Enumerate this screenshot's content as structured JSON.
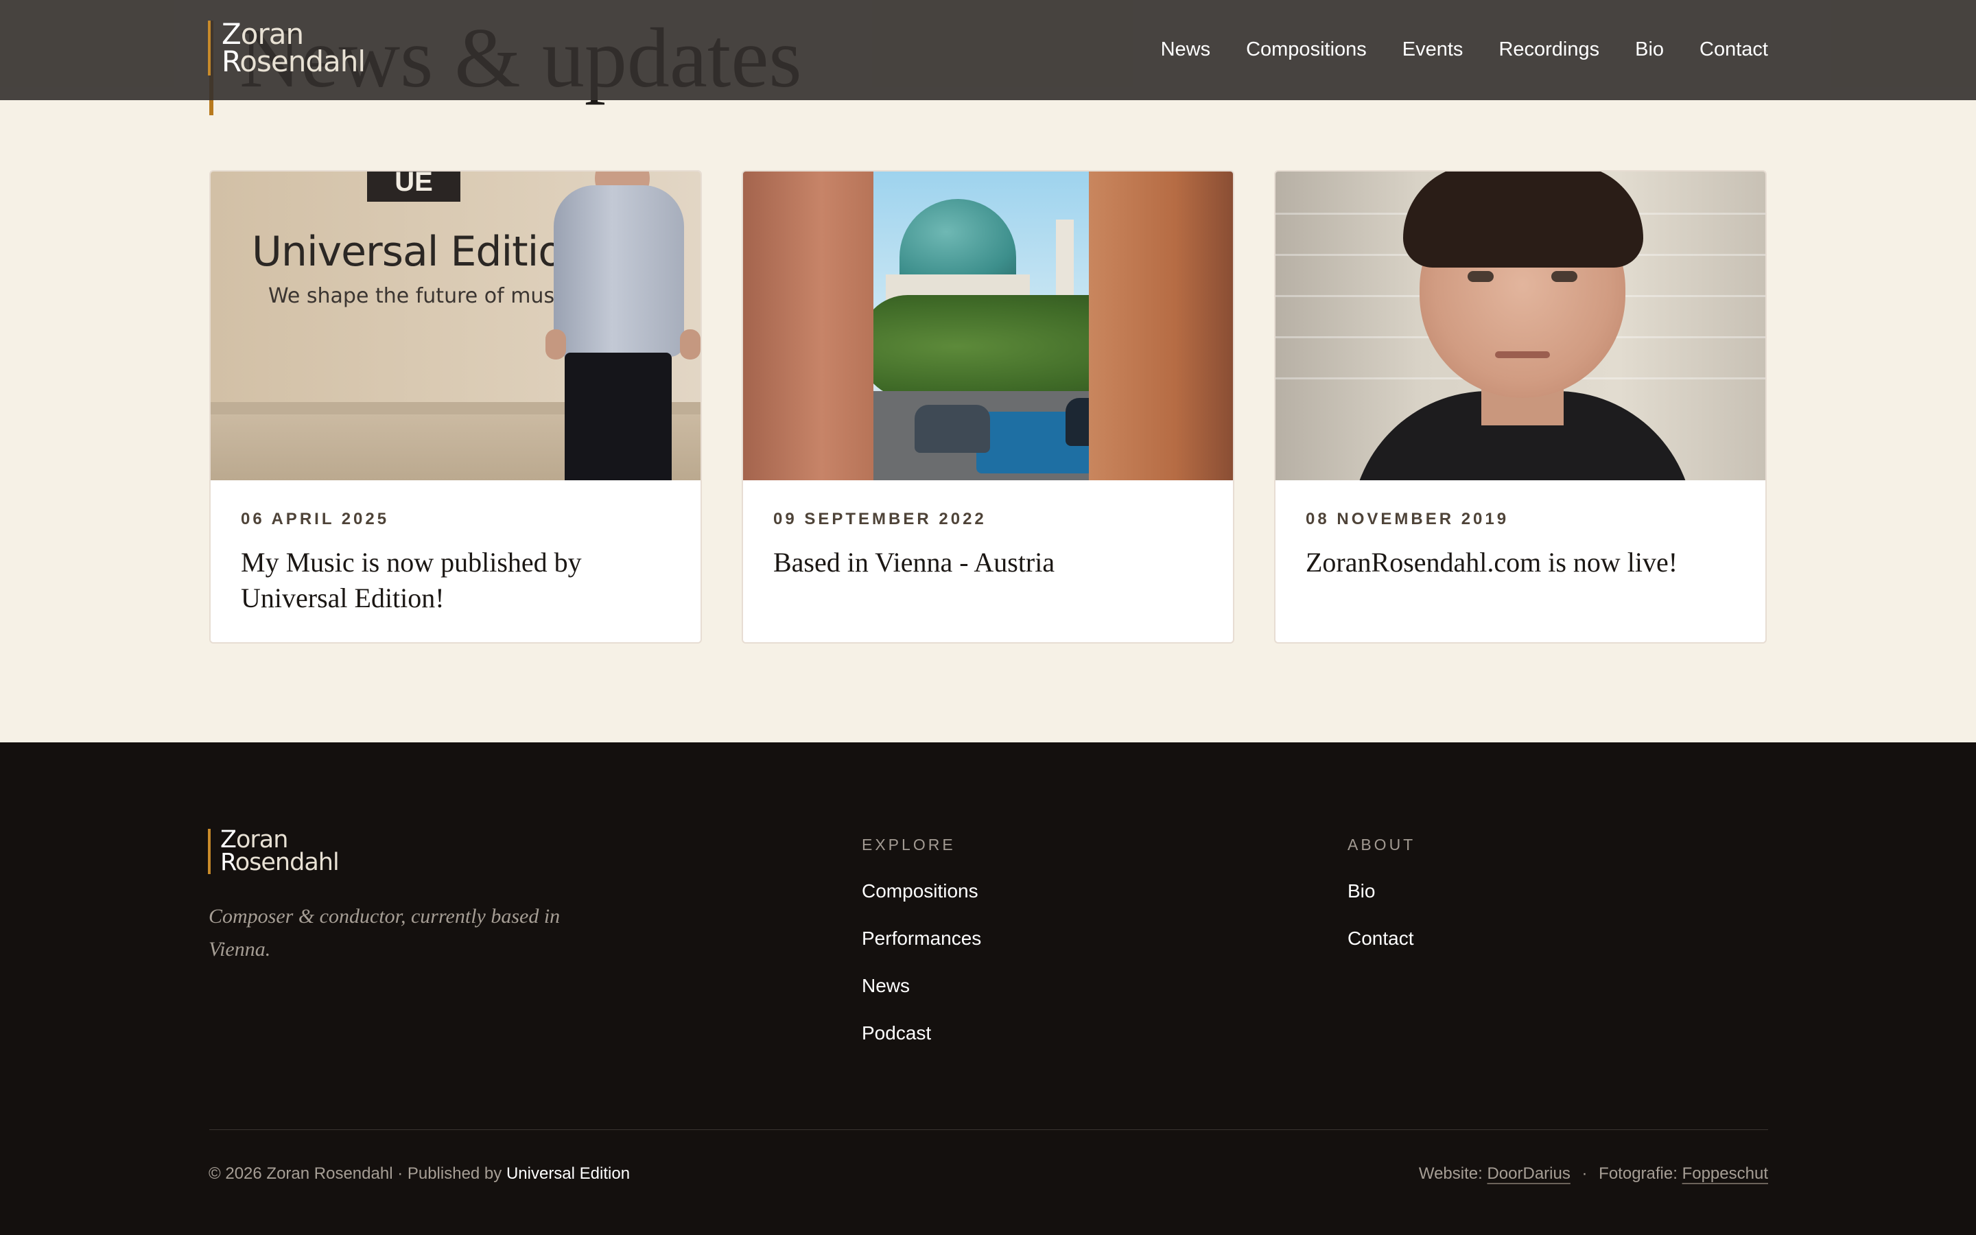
{
  "section": {
    "heading": "News & updates"
  },
  "header": {
    "logo": {
      "first_cap": "Z",
      "first_rest": "oran",
      "last_cap": "R",
      "last_rest": "osendahl"
    },
    "nav": [
      "News",
      "Compositions",
      "Events",
      "Recordings",
      "Bio",
      "Contact"
    ]
  },
  "cards": [
    {
      "date": "06 APRIL 2025",
      "title": "My Music is now published by Universal Edition!",
      "image": {
        "sign_badge": "UE",
        "sign_title": "Universal Edition",
        "sign_tagline": "We shape the future of music."
      }
    },
    {
      "date": "09 SEPTEMBER 2022",
      "title": "Based in Vienna - Austria"
    },
    {
      "date": "08 NOVEMBER 2019",
      "title": "ZoranRosendahl.com is now live!"
    }
  ],
  "footer": {
    "logo": {
      "first_cap": "Z",
      "first_rest": "oran",
      "last_cap": "R",
      "last_rest": "osendahl"
    },
    "tagline": "Composer & conductor, currently based in Vienna.",
    "explore": {
      "heading": "EXPLORE",
      "links": [
        "Compositions",
        "Performances",
        "News",
        "Podcast"
      ]
    },
    "about": {
      "heading": "ABOUT",
      "links": [
        "Bio",
        "Contact"
      ]
    },
    "copyright": "© 2026 Zoran Rosendahl · Published by ",
    "publisher": "Universal Edition",
    "website_label": "Website: ",
    "website_credit": "DoorDarius",
    "separator": " · ",
    "photo_label": "Fotografie: ",
    "photo_credit": "Foppeschut"
  },
  "colors": {
    "accent": "#c88a2a",
    "header_bg": "#34302d",
    "page_bg": "#f6f1e6",
    "footer_bg": "#14100e"
  }
}
